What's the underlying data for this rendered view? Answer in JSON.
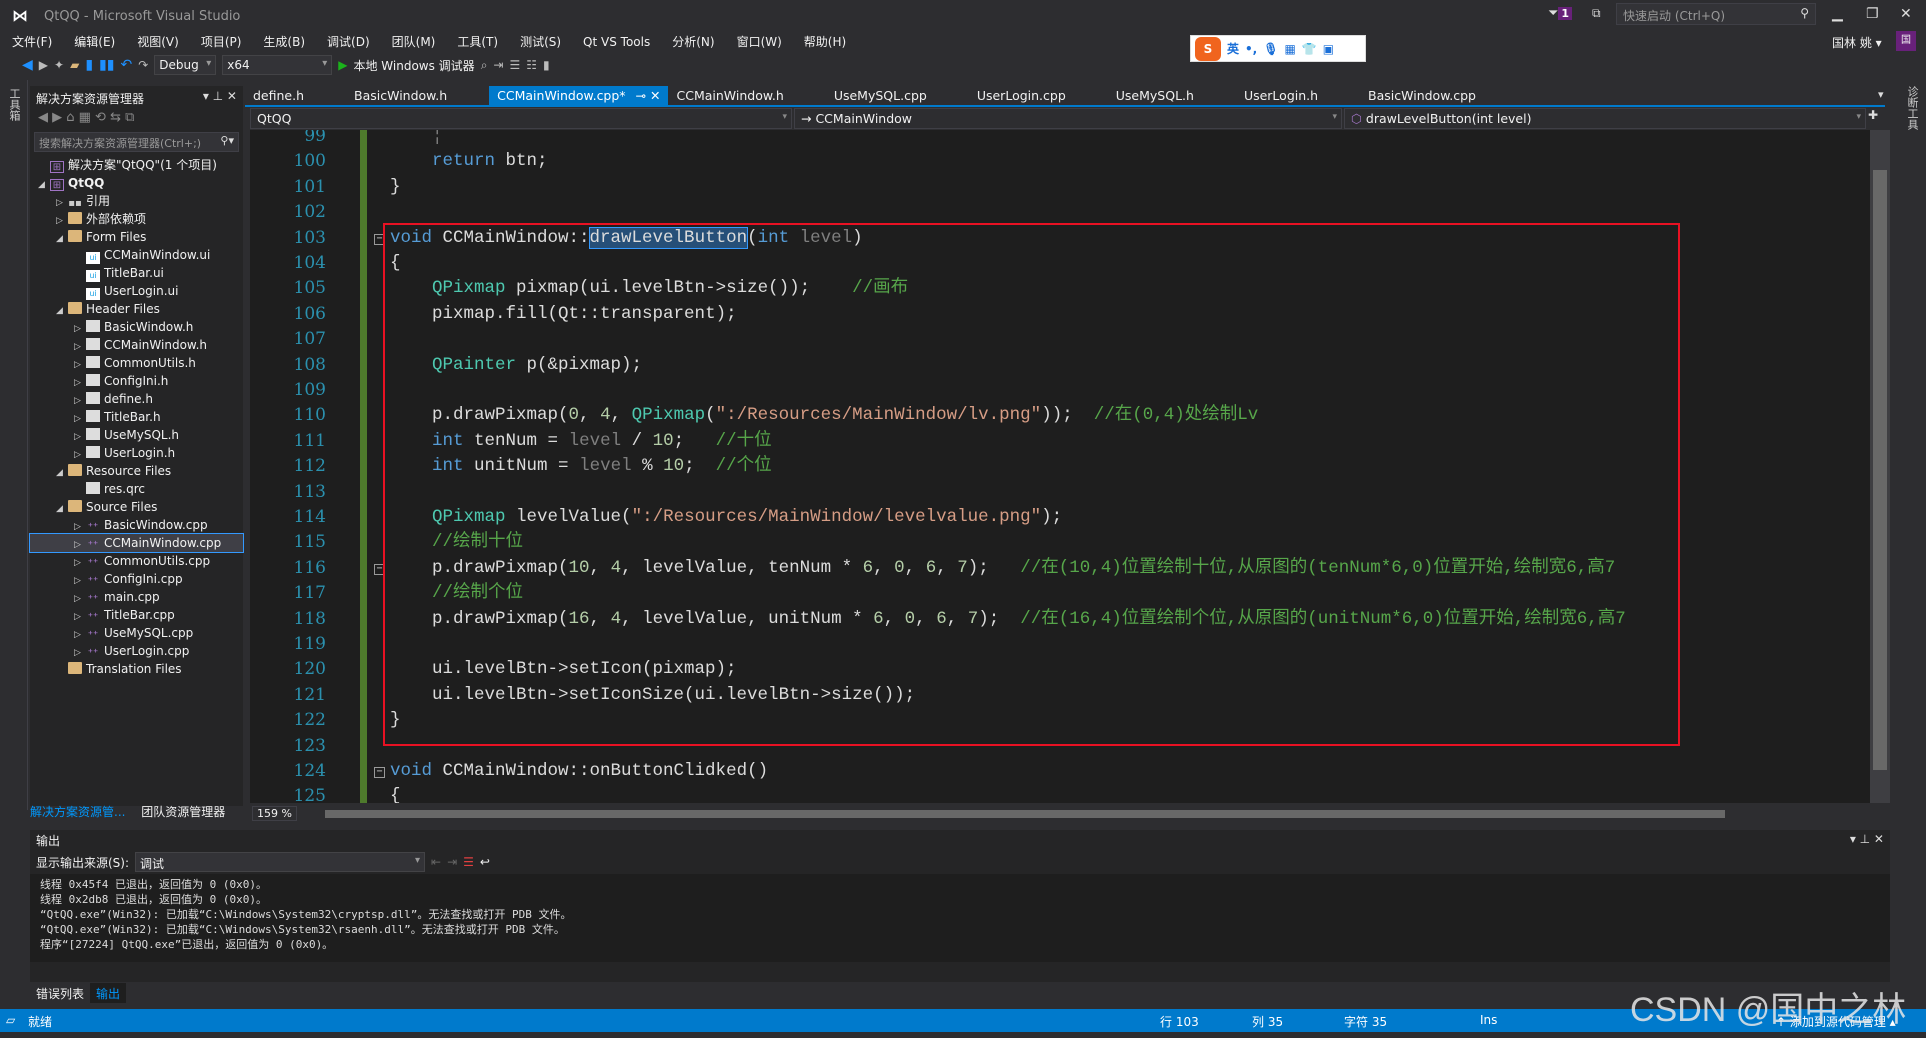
{
  "window": {
    "title": "QtQQ - Microsoft Visual Studio",
    "notifications": "1",
    "quick_launch": "快速启动 (Ctrl+Q)",
    "user": "国林 姚",
    "user_initial": "国"
  },
  "menu": [
    "文件(F)",
    "编辑(E)",
    "视图(V)",
    "项目(P)",
    "生成(B)",
    "调试(D)",
    "团队(M)",
    "工具(T)",
    "测试(S)",
    "Qt VS Tools",
    "分析(N)",
    "窗口(W)",
    "帮助(H)"
  ],
  "ime": {
    "lang": "英"
  },
  "toolbar": {
    "config": "Debug",
    "platform": "x64",
    "run": "本地 Windows 调试器"
  },
  "left_toolbox": "工具箱",
  "right_toolbox": "诊断工具",
  "solution_explorer": {
    "title": "解决方案资源管理器",
    "search_placeholder": "搜索解决方案资源管理器(Ctrl+;)",
    "items": [
      {
        "label": "解决方案\"QtQQ\"(1 个项目)",
        "depth": 0,
        "arrow": "",
        "icon": "proj"
      },
      {
        "label": "QtQQ",
        "depth": 0,
        "arrow": "◢",
        "icon": "proj",
        "bold": true
      },
      {
        "label": "引用",
        "depth": 1,
        "arrow": "▷",
        "icon": "ref"
      },
      {
        "label": "外部依赖项",
        "depth": 1,
        "arrow": "▷",
        "icon": "folder"
      },
      {
        "label": "Form Files",
        "depth": 1,
        "arrow": "◢",
        "icon": "folder"
      },
      {
        "label": "CCMainWindow.ui",
        "depth": 2,
        "arrow": "",
        "icon": "ui"
      },
      {
        "label": "TitleBar.ui",
        "depth": 2,
        "arrow": "",
        "icon": "ui"
      },
      {
        "label": "UserLogin.ui",
        "depth": 2,
        "arrow": "",
        "icon": "ui"
      },
      {
        "label": "Header Files",
        "depth": 1,
        "arrow": "◢",
        "icon": "folder"
      },
      {
        "label": "BasicWindow.h",
        "depth": 2,
        "arrow": "▷",
        "icon": "file"
      },
      {
        "label": "CCMainWindow.h",
        "depth": 2,
        "arrow": "▷",
        "icon": "file"
      },
      {
        "label": "CommonUtils.h",
        "depth": 2,
        "arrow": "▷",
        "icon": "file"
      },
      {
        "label": "ConfigIni.h",
        "depth": 2,
        "arrow": "▷",
        "icon": "file"
      },
      {
        "label": "define.h",
        "depth": 2,
        "arrow": "▷",
        "icon": "file"
      },
      {
        "label": "TitleBar.h",
        "depth": 2,
        "arrow": "▷",
        "icon": "file"
      },
      {
        "label": "UseMySQL.h",
        "depth": 2,
        "arrow": "▷",
        "icon": "file"
      },
      {
        "label": "UserLogin.h",
        "depth": 2,
        "arrow": "▷",
        "icon": "file"
      },
      {
        "label": "Resource Files",
        "depth": 1,
        "arrow": "◢",
        "icon": "folder"
      },
      {
        "label": "res.qrc",
        "depth": 2,
        "arrow": "",
        "icon": "file"
      },
      {
        "label": "Source Files",
        "depth": 1,
        "arrow": "◢",
        "icon": "folder"
      },
      {
        "label": "BasicWindow.cpp",
        "depth": 2,
        "arrow": "▷",
        "icon": "cpp"
      },
      {
        "label": "CCMainWindow.cpp",
        "depth": 2,
        "arrow": "▷",
        "icon": "cpp",
        "selected": true
      },
      {
        "label": "CommonUtils.cpp",
        "depth": 2,
        "arrow": "▷",
        "icon": "cpp"
      },
      {
        "label": "ConfigIni.cpp",
        "depth": 2,
        "arrow": "▷",
        "icon": "cpp"
      },
      {
        "label": "main.cpp",
        "depth": 2,
        "arrow": "▷",
        "icon": "cpp"
      },
      {
        "label": "TitleBar.cpp",
        "depth": 2,
        "arrow": "▷",
        "icon": "cpp"
      },
      {
        "label": "UseMySQL.cpp",
        "depth": 2,
        "arrow": "▷",
        "icon": "cpp"
      },
      {
        "label": "UserLogin.cpp",
        "depth": 2,
        "arrow": "▷",
        "icon": "cpp"
      },
      {
        "label": "Translation Files",
        "depth": 1,
        "arrow": "",
        "icon": "folder"
      }
    ],
    "tabs": [
      "解决方案资源管...",
      "团队资源管理器"
    ]
  },
  "tabs": [
    {
      "label": "define.h"
    },
    {
      "label": "BasicWindow.h"
    },
    {
      "label": "CCMainWindow.cpp*",
      "active": true
    },
    {
      "label": "CCMainWindow.h"
    },
    {
      "label": "UseMySQL.cpp"
    },
    {
      "label": "UserLogin.cpp"
    },
    {
      "label": "UseMySQL.h"
    },
    {
      "label": "UserLogin.h"
    },
    {
      "label": "BasicWindow.cpp"
    }
  ],
  "navbar": {
    "project": "QtQQ",
    "class": "→ CCMainWindow",
    "member": "drawLevelButton(int level)"
  },
  "editor": {
    "zoom": "159 %",
    "lines": [
      {
        "n": "99",
        "t": [
          [
            "",
            "    "
          ],
          [
            "pa",
            "¦"
          ]
        ]
      },
      {
        "n": "100",
        "t": [
          [
            "",
            "    "
          ],
          [
            "kw",
            "return"
          ],
          [
            "",
            " btn;"
          ]
        ]
      },
      {
        "n": "101",
        "t": [
          [
            "",
            "}"
          ]
        ]
      },
      {
        "n": "102",
        "t": []
      },
      {
        "n": "103",
        "fold": true,
        "t": [
          [
            "kw",
            "void"
          ],
          [
            "",
            " CCMainWindow::"
          ],
          [
            "sel",
            "drawLevelButton"
          ],
          [
            "",
            "("
          ],
          [
            "kw",
            "int"
          ],
          [
            "pa",
            " level"
          ],
          [
            "",
            ")"
          ]
        ]
      },
      {
        "n": "104",
        "t": [
          [
            "",
            "{"
          ]
        ]
      },
      {
        "n": "105",
        "t": [
          [
            "",
            "    "
          ],
          [
            "ty",
            "QPixmap"
          ],
          [
            "",
            " pixmap(ui.levelBtn->size());    "
          ],
          [
            "cm",
            "//画布"
          ]
        ]
      },
      {
        "n": "106",
        "t": [
          [
            "",
            "    pixmap.fill(Qt::"
          ],
          [
            "",
            "transparent"
          ],
          [
            "",
            ");"
          ]
        ]
      },
      {
        "n": "107",
        "t": []
      },
      {
        "n": "108",
        "t": [
          [
            "",
            "    "
          ],
          [
            "ty",
            "QPainter"
          ],
          [
            "",
            " p(&pixmap);"
          ]
        ]
      },
      {
        "n": "109",
        "t": []
      },
      {
        "n": "110",
        "t": [
          [
            "",
            "    p.drawPixmap("
          ],
          [
            "nm",
            "0"
          ],
          [
            ",",
            ", "
          ],
          [
            "nm",
            "4"
          ],
          [
            "",
            ", "
          ],
          [
            "ty",
            "QPixmap"
          ],
          [
            "",
            "("
          ],
          [
            "st",
            "\":/Resources/MainWindow/lv.png\""
          ],
          [
            "",
            "));  "
          ],
          [
            "cm",
            "//在(0,4)处绘制Lv"
          ]
        ]
      },
      {
        "n": "111",
        "t": [
          [
            "",
            "    "
          ],
          [
            "kw",
            "int"
          ],
          [
            "",
            " tenNum = "
          ],
          [
            "pa",
            "level"
          ],
          [
            "",
            " / "
          ],
          [
            "nm",
            "10"
          ],
          [
            "",
            ";   "
          ],
          [
            "cm",
            "//十位"
          ]
        ]
      },
      {
        "n": "112",
        "t": [
          [
            "",
            "    "
          ],
          [
            "kw",
            "int"
          ],
          [
            "",
            " unitNum = "
          ],
          [
            "pa",
            "level"
          ],
          [
            "",
            " % "
          ],
          [
            "nm",
            "10"
          ],
          [
            "",
            ";  "
          ],
          [
            "cm",
            "//个位"
          ]
        ]
      },
      {
        "n": "113",
        "t": []
      },
      {
        "n": "114",
        "t": [
          [
            "",
            "    "
          ],
          [
            "ty",
            "QPixmap"
          ],
          [
            "",
            " levelValue("
          ],
          [
            "st",
            "\":/Resources/MainWindow/levelvalue.png\""
          ],
          [
            "",
            ");"
          ]
        ]
      },
      {
        "n": "115",
        "t": [
          [
            "",
            "    "
          ],
          [
            "cm",
            "//绘制十位"
          ]
        ]
      },
      {
        "n": "116",
        "fold": true,
        "t": [
          [
            "",
            "    p.drawPixmap("
          ],
          [
            "nm",
            "10"
          ],
          [
            "",
            ", "
          ],
          [
            "nm",
            "4"
          ],
          [
            "",
            ", levelValue, tenNum * "
          ],
          [
            "nm",
            "6"
          ],
          [
            "",
            ", "
          ],
          [
            "nm",
            "0"
          ],
          [
            "",
            ", "
          ],
          [
            "nm",
            "6"
          ],
          [
            "",
            ", "
          ],
          [
            "nm",
            "7"
          ],
          [
            "",
            ");   "
          ],
          [
            "cm",
            "//在(10,4)位置绘制十位,从原图的(tenNum*6,0)位置开始,绘制宽6,高7"
          ]
        ]
      },
      {
        "n": "117",
        "t": [
          [
            "",
            "    "
          ],
          [
            "cm",
            "//绘制个位"
          ]
        ]
      },
      {
        "n": "118",
        "t": [
          [
            "",
            "    p.drawPixmap("
          ],
          [
            "nm",
            "16"
          ],
          [
            "",
            ", "
          ],
          [
            "nm",
            "4"
          ],
          [
            "",
            ", levelValue, unitNum * "
          ],
          [
            "nm",
            "6"
          ],
          [
            "",
            ", "
          ],
          [
            "nm",
            "0"
          ],
          [
            "",
            ", "
          ],
          [
            "nm",
            "6"
          ],
          [
            "",
            ", "
          ],
          [
            "nm",
            "7"
          ],
          [
            "",
            ");  "
          ],
          [
            "cm",
            "//在(16,4)位置绘制个位,从原图的(unitNum*6,0)位置开始,绘制宽6,高7"
          ]
        ]
      },
      {
        "n": "119",
        "t": []
      },
      {
        "n": "120",
        "t": [
          [
            "",
            "    ui.levelBtn->setIcon(pixmap);"
          ]
        ]
      },
      {
        "n": "121",
        "t": [
          [
            "",
            "    ui.levelBtn->setIconSize(ui.levelBtn->size());"
          ]
        ]
      },
      {
        "n": "122",
        "t": [
          [
            "",
            "}"
          ]
        ]
      },
      {
        "n": "123",
        "t": []
      },
      {
        "n": "124",
        "fold": true,
        "t": [
          [
            "kw",
            "void"
          ],
          [
            "",
            " CCMainWindow::onButtonClidked()"
          ]
        ]
      },
      {
        "n": "125",
        "t": [
          [
            "",
            "{"
          ]
        ]
      }
    ]
  },
  "output": {
    "title": "输出",
    "source_label": "显示输出来源(S):",
    "source_value": "调试",
    "lines": [
      "线程 0x45f4 已退出，返回值为 0 (0x0)。",
      "线程 0x2db8 已退出，返回值为 0 (0x0)。",
      "“QtQQ.exe”(Win32): 已加载“C:\\Windows\\System32\\cryptsp.dll”。无法查找或打开 PDB 文件。",
      "“QtQQ.exe”(Win32): 已加载“C:\\Windows\\System32\\rsaenh.dll”。无法查找或打开 PDB 文件。",
      "程序“[27224] QtQQ.exe”已退出，返回值为 0 (0x0)。"
    ]
  },
  "bottom_tabs": [
    "错误列表",
    "输出"
  ],
  "status": {
    "ready": "就绪",
    "line": "行 103",
    "col": "列 35",
    "char": "字符 35",
    "mode": "Ins",
    "source_control": "↑ 添加到源代码管理 ▴"
  },
  "watermark": "CSDN @国中之林"
}
